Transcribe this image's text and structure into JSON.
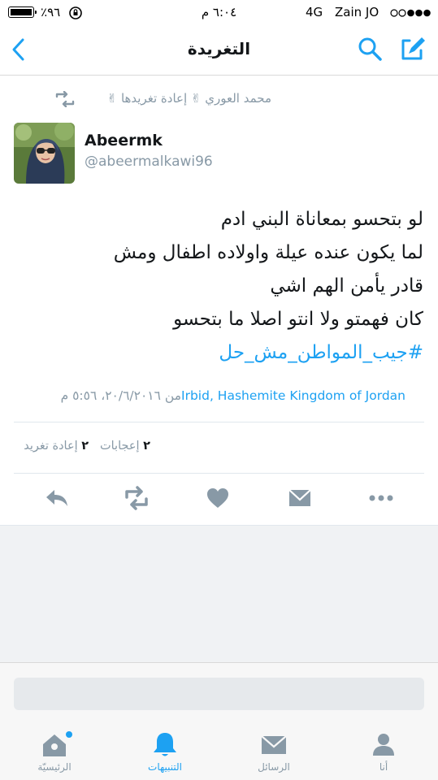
{
  "status_bar": {
    "battery_percent": "٪٩٦",
    "time": "٦:٠٤ م",
    "network": "4G",
    "carrier": "Zain JO"
  },
  "nav": {
    "title": "التغريدة"
  },
  "retweet_context": {
    "text": "محمد العوري ✌ إعادة تغريدها ✌"
  },
  "tweet": {
    "display_name": "Abeermk",
    "handle": "@abeermalkawi96",
    "lines": [
      "لو بتحسو بمعاناة البني ادم",
      "لما يكون عنده عيلة واولاده اطفال ومش",
      "قادر يأمن الهم اشي",
      "كان فهمتو ولا انتو اصلا ما بتحسو"
    ],
    "hashtag": "#جيب_المواطن_مش_حل",
    "location": "Irbid, Hashemite Kingdom of Jordan",
    "from_label": "من",
    "timestamp": "٢٠/٦/٢٠١٦، ٥:٥٦ م"
  },
  "stats": {
    "likes_count": "٢",
    "likes_label": "إعجابات",
    "retweets_count": "٢",
    "retweets_label": "إعادة تغريد"
  },
  "actions": [
    "reply-icon",
    "retweet-icon",
    "heart-icon",
    "message-icon",
    "more-icon"
  ],
  "tabs": [
    {
      "label": "الرئيسيّة",
      "icon": "home-icon"
    },
    {
      "label": "التنبيهات",
      "icon": "bell-icon"
    },
    {
      "label": "الرسائل",
      "icon": "envelope-icon"
    },
    {
      "label": "أنا",
      "icon": "person-icon"
    }
  ],
  "colors": {
    "accent": "#1da1f2",
    "secondary_text": "#8899a6",
    "primary_text": "#14171a",
    "action_icon": "#8899a6"
  }
}
